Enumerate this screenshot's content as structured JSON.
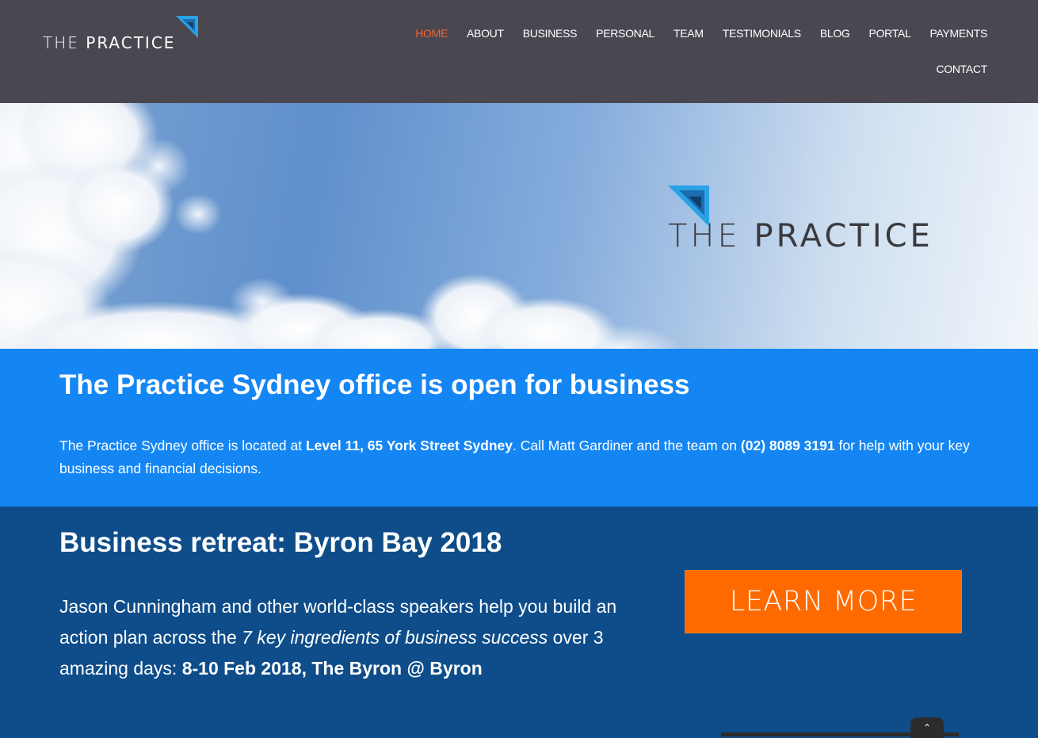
{
  "brand": {
    "logo_text_thin": "THE",
    "logo_text_bold": "PRACTICE",
    "accent_color": "#f2622a",
    "logo_mark_color": "#1a8fd6"
  },
  "nav": {
    "items_row1": [
      {
        "label": "HOME",
        "active": true
      },
      {
        "label": "ABOUT",
        "active": false
      },
      {
        "label": "BUSINESS",
        "active": false
      },
      {
        "label": "PERSONAL",
        "active": false
      },
      {
        "label": "TEAM",
        "active": false
      },
      {
        "label": "TESTIMONIALS",
        "active": false
      },
      {
        "label": "BLOG",
        "active": false
      },
      {
        "label": "PORTAL",
        "active": false
      },
      {
        "label": "PAYMENTS",
        "active": false
      }
    ],
    "items_row2": [
      {
        "label": "CONTACT",
        "active": false
      }
    ]
  },
  "hero": {
    "logo_text_thin": "THE",
    "logo_text_bold": "PRACTICE"
  },
  "office": {
    "heading": "The Practice Sydney office is open for business",
    "text_1": "The Practice Sydney office is located at ",
    "address": "Level 11, 65 York Street Sydney",
    "text_2": ". Call Matt Gardiner and the team on ",
    "phone": "(02) 8089 3191",
    "text_3": " for help with your key business and financial decisions."
  },
  "retreat": {
    "heading": "Business retreat: Byron Bay 2018",
    "text_1": "Jason Cunningham and other world-class speakers help you build an action plan across the ",
    "emphasis": "7 key ingredients of business success",
    "text_2": " over 3 amazing days: ",
    "dates": "8-10 Feb 2018, The Byron @ Byron",
    "button_label": "LEARN MORE",
    "button_color": "#ff6a00"
  },
  "scroll_top": {
    "icon": "chevron-up-icon",
    "glyph": "⌃"
  }
}
